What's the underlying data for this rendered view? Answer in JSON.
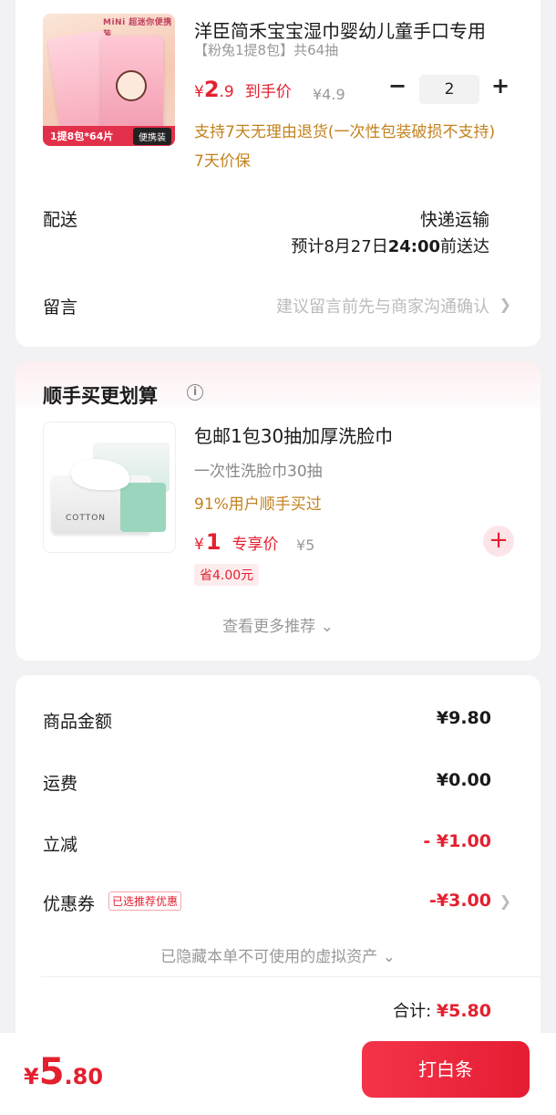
{
  "product": {
    "title": "洋臣简禾宝宝湿巾婴幼儿童手口专用",
    "spec": "【粉兔1提8包】共64抽",
    "price_symbol": "¥",
    "price_int": "2",
    "price_dec": ".9",
    "price_label": "到手价",
    "orig_price": "¥4.9",
    "quantity": "2",
    "guarantee": "支持7天无理由退货(一次性包装破损不支持)",
    "price_protect": "7天价保",
    "thumb_top": "MiNi 超迷你便携装",
    "thumb_badge": "1提8包*64片",
    "thumb_badge_tag": "便携装"
  },
  "delivery": {
    "label": "配送",
    "method": "快递运输",
    "eta_prefix": "预计8月27日",
    "eta_time": "24:00",
    "eta_suffix": "前送达"
  },
  "message": {
    "label": "留言",
    "hint": "建议留言前先与商家沟通确认"
  },
  "upsell": {
    "heading": "顺手买更划算",
    "title": "包邮1包30抽加厚洗脸巾",
    "subtitle": "一次性洗脸巾30抽",
    "social_proof": "91%用户顺手买过",
    "price_symbol": "¥",
    "price": "1",
    "price_label": "专享价",
    "orig_price": "¥5",
    "saving": "省4.00元",
    "thumb_text": "COTTON",
    "more": "查看更多推荐"
  },
  "summary": {
    "goods_label": "商品金额",
    "goods_value": "¥9.80",
    "shipping_label": "运费",
    "shipping_value": "¥0.00",
    "discount_label": "立减",
    "discount_value": "- ¥1.00",
    "coupon_label": "优惠券",
    "coupon_tag": "已选推荐优惠",
    "coupon_value": "-¥3.00",
    "hidden_assets": "已隐藏本单不可使用的虚拟资产",
    "total_label": "合计:",
    "total_value": "¥5.80"
  },
  "bottom": {
    "price_symbol": "¥",
    "price_int": "5",
    "price_dec": ".80",
    "pay_button": "打白条"
  },
  "colors": {
    "accent": "#e4202f",
    "gold": "#c3821e",
    "muted": "#999999"
  }
}
